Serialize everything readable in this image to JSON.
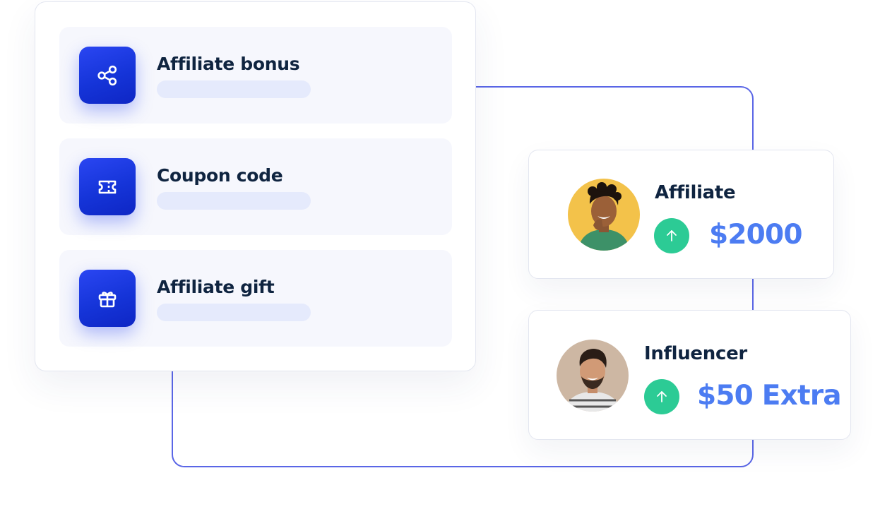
{
  "features": [
    {
      "title": "Affiliate bonus",
      "icon": "share-icon"
    },
    {
      "title": "Coupon code",
      "icon": "ticket-icon"
    },
    {
      "title": "Affiliate gift",
      "icon": "gift-icon"
    }
  ],
  "people": [
    {
      "name": "Affiliate",
      "amount": "$2000",
      "indicator": "arrow-up-icon"
    },
    {
      "name": "Influencer",
      "amount": "$50 Extra",
      "indicator": "arrow-up-icon"
    }
  ],
  "colors": {
    "accent": "#1534d8",
    "connector": "#5a66e6",
    "success": "#2ccb95",
    "amount": "#4c7cf2",
    "title": "#0f2440",
    "row_bg": "#f6f7fd",
    "bar_bg": "#e5eafc"
  }
}
